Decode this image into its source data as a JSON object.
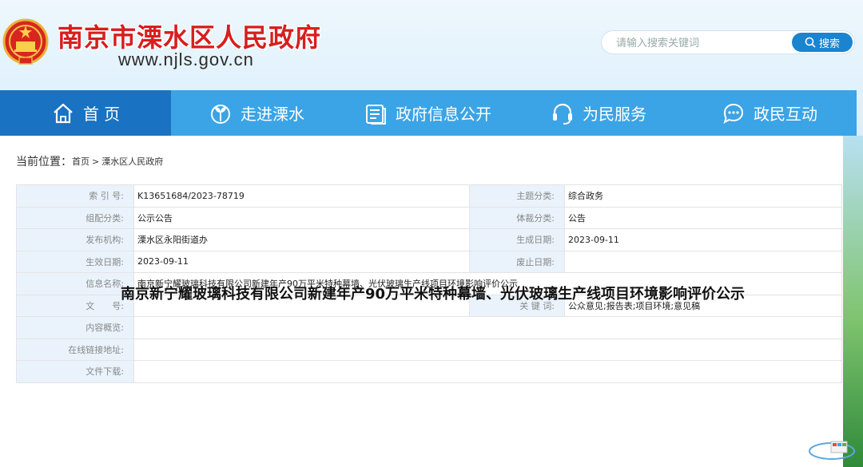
{
  "header": {
    "site_title": "南京市溧水区人民政府",
    "site_url": "www.njls.gov.cn",
    "search_placeholder": "请输入搜索关键词",
    "search_button": "搜索"
  },
  "nav": [
    {
      "label": "首 页",
      "icon": "home-icon",
      "active": true
    },
    {
      "label": "走进溧水",
      "icon": "sprout-icon",
      "active": false
    },
    {
      "label": "政府信息公开",
      "icon": "document-icon",
      "active": false
    },
    {
      "label": "为民服务",
      "icon": "headset-icon",
      "active": false
    },
    {
      "label": "政民互动",
      "icon": "chat-icon",
      "active": false
    }
  ],
  "breadcrumb": {
    "label": "当前位置：",
    "items": [
      "首页",
      "溧水区人民政府"
    ],
    "separator": ">"
  },
  "meta": {
    "index_no_label": "索 引 号:",
    "index_no": "K13651684/2023-78719",
    "subject_label": "主题分类:",
    "subject": "综合政务",
    "category_label": "组配分类:",
    "category": "公示公告",
    "genre_label": "体裁分类:",
    "genre": "公告",
    "publisher_label": "发布机构:",
    "publisher": "溧水区永阳街道办",
    "created_label": "生成日期:",
    "created": "2023-09-11",
    "effective_label": "生效日期:",
    "effective": "2023-09-11",
    "repealed_label": "废止日期:",
    "repealed": "",
    "name_label": "信息名称:",
    "name": "南京新宁耀玻璃科技有限公司新建年产90万平米特种幕墙、光伏玻璃生产线项目环境影响评价公示",
    "doc_no_label": "文　　号:",
    "doc_no": "",
    "keywords_label": "关 键 词:",
    "keywords": "公众意见;报告表;项目环境;意见稿",
    "summary_label": "内容概览:",
    "summary": "",
    "link_label": "在线链接地址:",
    "link": "",
    "download_label": "文件下载:",
    "download": ""
  },
  "document": {
    "title": "南京新宁耀玻璃科技有限公司新建年产90万平米特种幕墙、光伏玻璃生产线项目环境影响评价公示"
  },
  "colors": {
    "nav_bg": "#3ba4e6",
    "nav_active": "#1a72c2",
    "title_red": "#d81e1e",
    "search_btn": "#1a84d0"
  }
}
